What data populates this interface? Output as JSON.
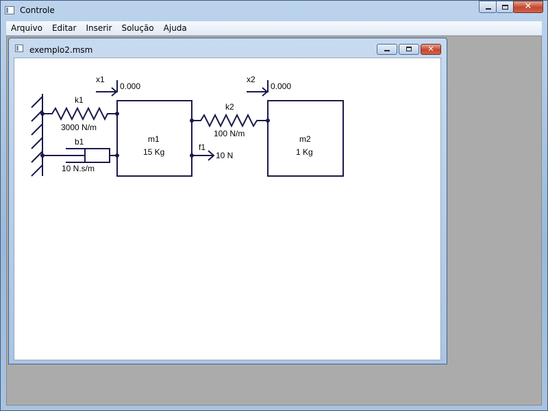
{
  "app": {
    "title": "Controle"
  },
  "menu": [
    "Arquivo",
    "Editar",
    "Inserir",
    "Solução",
    "Ajuda"
  ],
  "child": {
    "title": "exemplo2.msm"
  },
  "diagram": {
    "x1_label": "x1",
    "x1_value": "0.000",
    "x2_label": "x2",
    "x2_value": "0.000",
    "k1_label": "k1",
    "k1_value": "3000 N/m",
    "b1_label": "b1",
    "b1_value": "10 N.s/m",
    "m1_label": "m1",
    "m1_value": "15 Kg",
    "k2_label": "k2",
    "k2_value": "100 N/m",
    "f1_label": "f1",
    "f1_value": "10 N",
    "m2_label": "m2",
    "m2_value": "1 Kg"
  },
  "colors": {
    "ink": "#1a1a4a",
    "canvas": "#ffffff",
    "mdi": "#ababab"
  }
}
